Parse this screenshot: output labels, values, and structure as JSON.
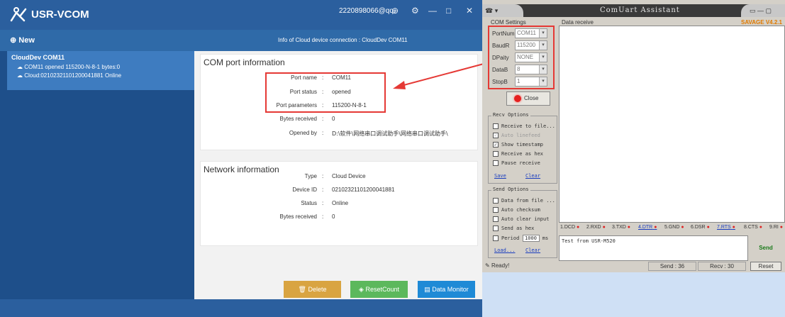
{
  "vcom": {
    "logo_icon": "usr-logo-icon",
    "app_name": "USR-VCOM",
    "account": "2220898066@qq.",
    "new_label": "New",
    "conn_info": "Info of Cloud device connection : CloudDev COM11",
    "device": {
      "name": "CloudDev COM11",
      "line1": "COM11 opened 115200-N-8-1 bytes:0",
      "line2": "Cloud:02102321101200041881 Online"
    },
    "com_panel": {
      "title": "COM port information",
      "rows": [
        {
          "label": "Port name",
          "sep": ":",
          "value": "COM11"
        },
        {
          "label": "Port status",
          "sep": ":",
          "value": "opened"
        },
        {
          "label": "Port parameters",
          "sep": ":",
          "value": "115200-N-8-1"
        },
        {
          "label": "Bytes received",
          "sep": ":",
          "value": "0"
        },
        {
          "label": "Opened by",
          "sep": ":",
          "value": "D:\\软件\\网络串口调试助手\\网络串口调试助手\\"
        }
      ]
    },
    "net_panel": {
      "title": "Network information",
      "rows": [
        {
          "label": "Type",
          "sep": ":",
          "value": "Cloud Device"
        },
        {
          "label": "Device ID",
          "sep": ":",
          "value": "02102321101200041881"
        },
        {
          "label": "Status",
          "sep": ":",
          "value": "Online"
        },
        {
          "label": "Bytes received",
          "sep": ":",
          "value": "0"
        }
      ]
    },
    "buttons": {
      "delete": "Delete",
      "reset": "ResetCount",
      "monitor": "Data Monitor"
    },
    "colors": {
      "delete": "#d9a441",
      "reset": "#5cb85c",
      "monitor": "#1f8ad6",
      "highlight": "#e53935"
    }
  },
  "cua": {
    "title": "ComUart Assistant",
    "com_settings_label": "COM Settings",
    "settings": [
      {
        "label": "PortNum",
        "value": "COM11"
      },
      {
        "label": "BaudR",
        "value": "115200"
      },
      {
        "label": "DPaity",
        "value": "NONE"
      },
      {
        "label": "DataB",
        "value": "8"
      },
      {
        "label": "StopB",
        "value": "1"
      }
    ],
    "close_label": "Close",
    "recv_options": {
      "title": "Recv Options",
      "items": [
        {
          "label": "Receive to file...",
          "checked": false,
          "disabled": false
        },
        {
          "label": "Auto linefeed",
          "checked": true,
          "disabled": true
        },
        {
          "label": "Show timestamp",
          "checked": true,
          "disabled": false
        },
        {
          "label": "Receive as hex",
          "checked": false,
          "disabled": false
        },
        {
          "label": "Pause receive",
          "checked": false,
          "disabled": false
        }
      ],
      "save": "Save",
      "clear": "Clear"
    },
    "send_options": {
      "title": "Send Options",
      "items": [
        {
          "label": "Data from file ...",
          "checked": false
        },
        {
          "label": "Auto checksum",
          "checked": false
        },
        {
          "label": "Auto clear input",
          "checked": false
        },
        {
          "label": "Send as hex",
          "checked": false
        }
      ],
      "period_label": "Period",
      "period_value": "1000",
      "period_unit": "ms",
      "load": "Load...",
      "clear": "Clear"
    },
    "data_receive_label": "Data receive",
    "savage": "SAVAGE V4.2.1",
    "pins": [
      "1.DCD",
      "2.RXD",
      "3.TXD",
      "4.DTR",
      "5.GND",
      "6.DSR",
      "7.RTS",
      "8.CTS",
      "9.RI"
    ],
    "send_text": "Test from USR-M520",
    "send_label": "Send",
    "status": {
      "ready": "Ready!",
      "send": "Send : 36",
      "recv": "Recv : 30",
      "reset": "Reset"
    }
  }
}
